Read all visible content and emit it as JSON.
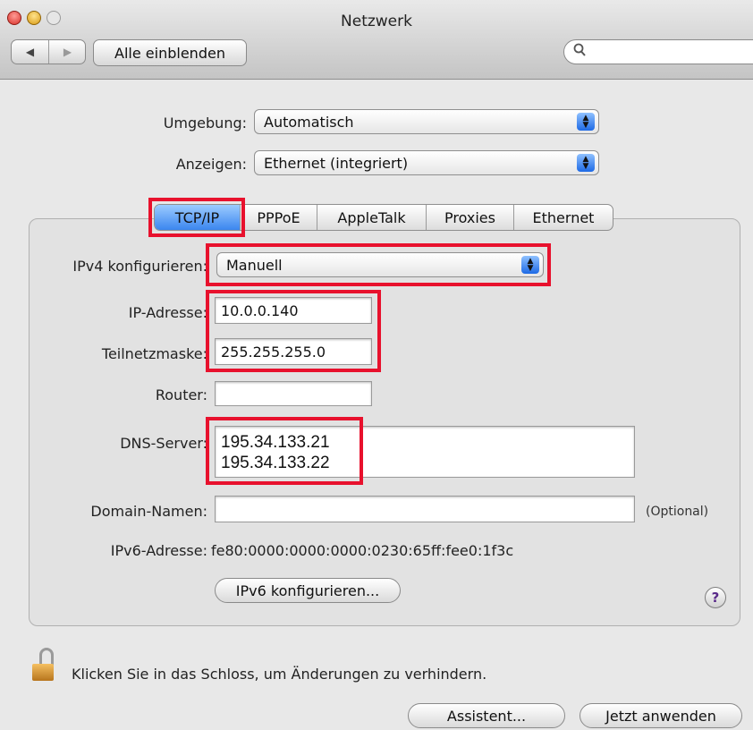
{
  "window": {
    "title": "Netzwerk"
  },
  "toolbar": {
    "back_glyph": "◀",
    "forward_glyph": "▶",
    "show_all_label": "Alle einblenden",
    "search_placeholder": "",
    "search_icon_glyph": "🔍"
  },
  "location": {
    "label": "Umgebung:",
    "value": "Automatisch"
  },
  "show": {
    "label": "Anzeigen:",
    "value": "Ethernet (integriert)"
  },
  "tabs": [
    {
      "label": "TCP/IP",
      "selected": true
    },
    {
      "label": "PPPoE",
      "selected": false
    },
    {
      "label": "AppleTalk",
      "selected": false
    },
    {
      "label": "Proxies",
      "selected": false
    },
    {
      "label": "Ethernet",
      "selected": false
    }
  ],
  "tcpip": {
    "ipv4_config": {
      "label": "IPv4 konfigurieren:",
      "value": "Manuell"
    },
    "ip_address": {
      "label": "IP-Adresse:",
      "value": "10.0.0.140"
    },
    "subnet_mask": {
      "label": "Teilnetzmaske:",
      "value": "255.255.255.0"
    },
    "router": {
      "label": "Router:",
      "value": ""
    },
    "dns_servers": {
      "label": "DNS-Server:",
      "values": [
        "195.34.133.21",
        "195.34.133.22"
      ]
    },
    "domain_names": {
      "label": "Domain-Namen:",
      "value": "",
      "hint": "(Optional)"
    },
    "ipv6_address": {
      "label": "IPv6-Adresse:",
      "value": "fe80:0000:0000:0000:0230:65ff:fee0:1f3c"
    },
    "ipv6_config_button": "IPv6 konfigurieren...",
    "help_glyph": "?"
  },
  "footer": {
    "lock_text": "Klicken Sie in das Schloss, um Änderungen zu verhindern.",
    "assistant_button": "Assistent...",
    "apply_button": "Jetzt anwenden"
  },
  "colors": {
    "highlight": "#e8112d",
    "selected_tab": "#3b86ef"
  }
}
